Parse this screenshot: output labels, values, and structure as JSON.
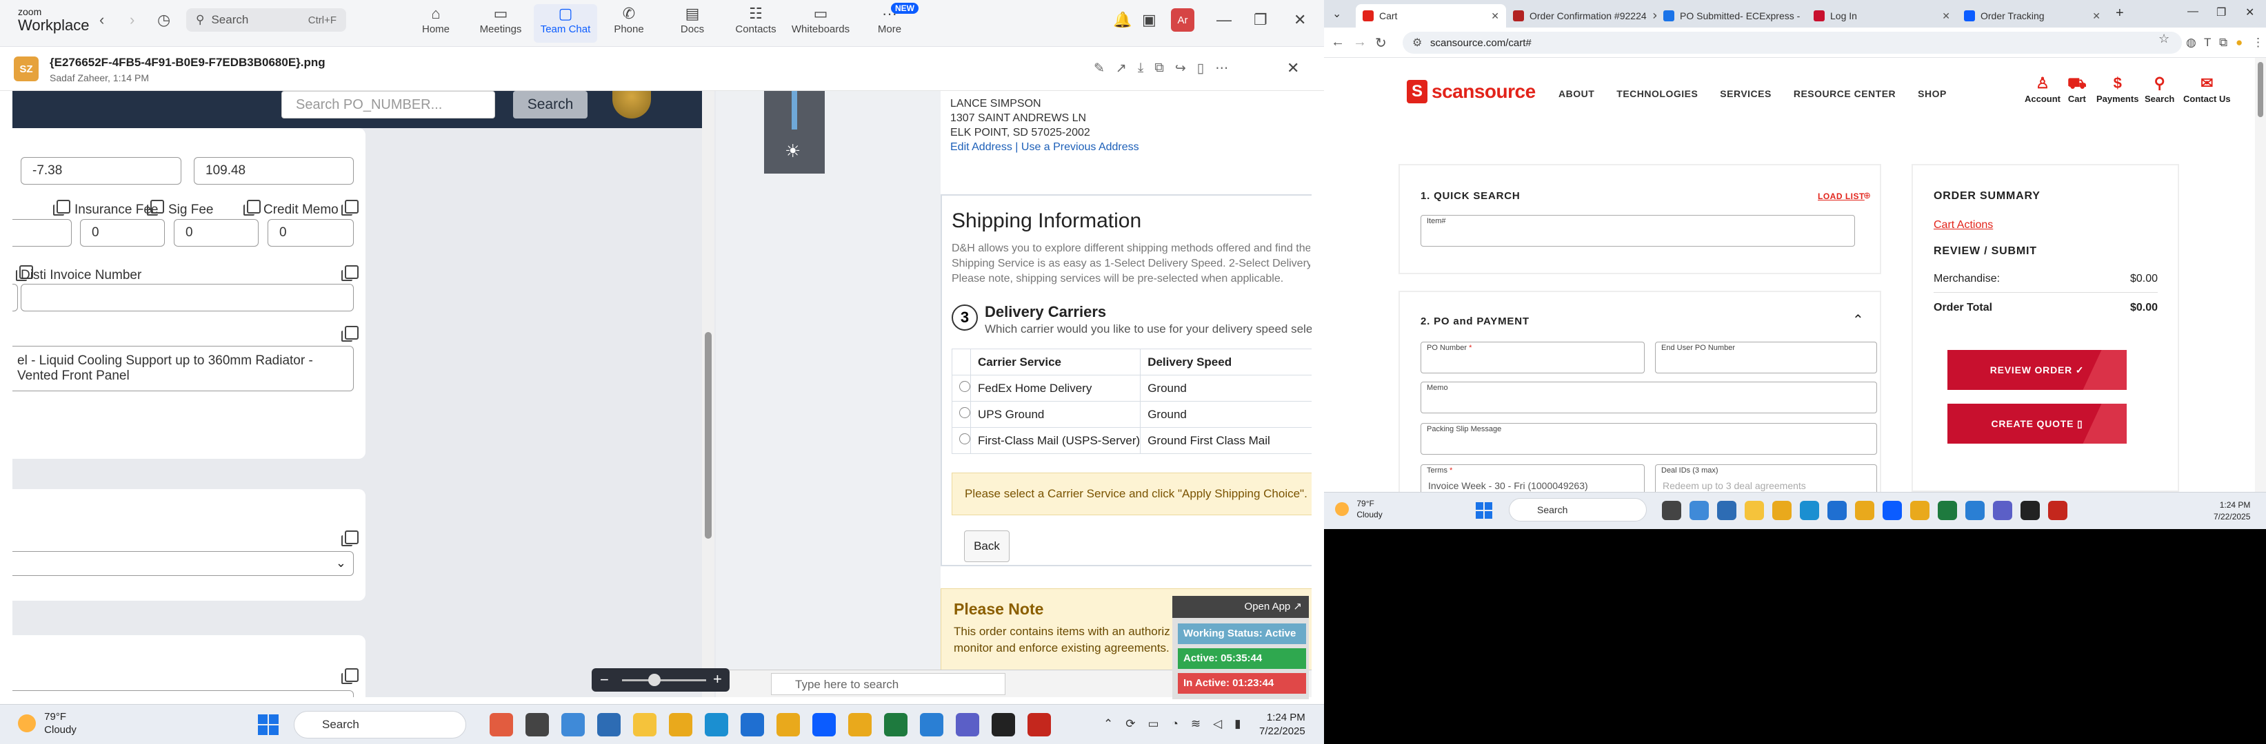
{
  "zoom": {
    "logo_top": "zoom",
    "logo_bottom": "Workplace",
    "search_label": "Search",
    "search_shortcut": "Ctrl+F",
    "tabs": [
      {
        "label": "Home",
        "icon": "home-icon",
        "glyph": "⌂"
      },
      {
        "label": "Meetings",
        "icon": "video-icon",
        "glyph": "▭"
      },
      {
        "label": "Team Chat",
        "icon": "chat-icon",
        "glyph": "▢"
      },
      {
        "label": "Phone",
        "icon": "phone-icon",
        "glyph": "✆"
      },
      {
        "label": "Docs",
        "icon": "docs-icon",
        "glyph": "▤"
      },
      {
        "label": "Contacts",
        "icon": "contacts-icon",
        "glyph": "☷"
      },
      {
        "label": "Whiteboards",
        "icon": "whiteboard-icon",
        "glyph": "▭"
      },
      {
        "label": "More",
        "icon": "more-icon",
        "glyph": "···"
      }
    ],
    "new_badge": "NEW",
    "avatar_initials": "Ar",
    "file": {
      "avatar": "SZ",
      "name": "{E276652F-4FB5-4F91-B0E9-F7EDB3B0680E}.png",
      "sub": "Sadaf Zaheer, 1:14 PM"
    }
  },
  "form": {
    "search_placeholder": "Search PO_NUMBER...",
    "search_button": "Search",
    "value_a": "-7.38",
    "value_b": "109.48",
    "insurance_fee_label": "Insurance Fee",
    "insurance_fee": "0",
    "sig_fee_label": "Sig Fee",
    "sig_fee": "0",
    "credit_memo_label": "Credit Memo",
    "credit_memo": "0",
    "disti_invoice_label": "Disti Invoice Number",
    "disti_invoice": "",
    "description": "el - Liquid Cooling Support up to 360mm Radiator - Vented Front Panel"
  },
  "shipping": {
    "addr_name": "LANCE SIMPSON",
    "addr_line1": "1307 SAINT ANDREWS LN",
    "addr_line2": "ELK POINT, SD 57025-2002",
    "edit_address": "Edit Address",
    "sep": "|",
    "previous_address": "Use a Previous Address",
    "title": "Shipping Information",
    "desc1": "D&H allows you to explore different shipping methods offered and find the",
    "desc2": "Shipping Service is as easy as 1-Select Delivery Speed. 2-Select Delivery A",
    "desc3": "Please note, shipping services will be pre-selected when applicable.",
    "step_number": "3",
    "step_title": "Delivery Carriers",
    "step_sub": "Which carrier would you like to use for your delivery speed sele",
    "col_carrier": "Carrier Service",
    "col_speed": "Delivery Speed",
    "rows": [
      {
        "carrier": "FedEx Home Delivery",
        "speed": "Ground"
      },
      {
        "carrier": "UPS Ground",
        "speed": "Ground"
      },
      {
        "carrier": "First-Class Mail (USPS-Server)",
        "speed": "Ground First Class Mail"
      }
    ],
    "warning": "Please select a Carrier Service and click \"Apply Shipping Choice\".",
    "back": "Back",
    "note_title": "Please Note",
    "note_line1": "This order contains items with an authoriz",
    "note_line2": "monitor and enforce existing agreements."
  },
  "work_status": {
    "open_app": "Open App ↗",
    "status": "Working Status: Active",
    "active": "Active: 05:35:44",
    "inactive": "In Active: 01:23:44",
    "colors": {
      "status": "#6aaac9",
      "active": "#2fa84f",
      "inactive": "#e04848"
    }
  },
  "embedded_search": "Type here to search",
  "taskbar_left": {
    "temp": "79°F",
    "cond": "Cloudy",
    "search": "Search",
    "time": "1:24 PM",
    "date": "7/22/2025"
  },
  "chrome": {
    "tabs": [
      {
        "label": "Cart",
        "color": "#e2231a"
      },
      {
        "label": "Order Confirmation #92224",
        "color": "#b22222"
      },
      {
        "label": "PO Submitted- ECExpress -",
        "color": "#1a73e8"
      },
      {
        "label": "Log In",
        "color": "#c8102e"
      },
      {
        "label": "Order Tracking",
        "color": "#0b5cff"
      }
    ],
    "url": "scansource.com/cart#"
  },
  "scansource": {
    "logo": "scansource",
    "menu": [
      "ABOUT",
      "TECHNOLOGIES",
      "SERVICES",
      "RESOURCE CENTER",
      "SHOP"
    ],
    "utils": [
      {
        "label": "Account",
        "glyph": "♙"
      },
      {
        "label": "Cart",
        "glyph": "⛟"
      },
      {
        "label": "Payments",
        "glyph": "$"
      },
      {
        "label": "Search",
        "glyph": "⚲"
      },
      {
        "label": "Contact Us",
        "glyph": "✉"
      }
    ],
    "quick_search_title": "1. QUICK SEARCH",
    "load_list": "LOAD LIST",
    "item_label": "Item#",
    "po_title": "2. PO and PAYMENT",
    "po_number_label": "PO Number",
    "end_user_po_label": "End User PO Number",
    "memo_label": "Memo",
    "packing_label": "Packing Slip Message",
    "terms_label": "Terms",
    "terms_value": "Invoice Week - 30 - Fri (1000049263)",
    "deal_label": "Deal IDs (3 max)",
    "deal_placeholder": "Redeem up to 3 deal agreements",
    "required": "*",
    "summary_title": "ORDER SUMMARY",
    "cart_actions": "Cart Actions",
    "review_submit": "REVIEW / SUBMIT",
    "merch_label": "Merchandise:",
    "merch_value": "$0.00",
    "total_label": "Order Total",
    "total_value": "$0.00",
    "review_order_btn": "REVIEW ORDER ✓",
    "create_quote_btn": "CREATE QUOTE ▯"
  },
  "taskbar_right": {
    "temp": "79°F",
    "cond": "Cloudy",
    "search": "Search",
    "time": "1:24 PM",
    "date": "7/22/2025"
  }
}
